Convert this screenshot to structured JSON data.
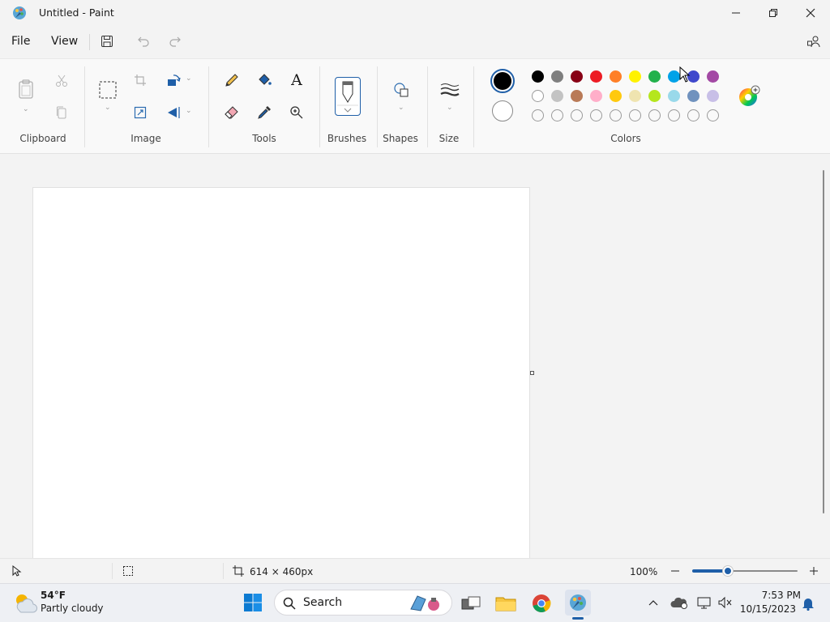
{
  "window": {
    "title": "Untitled - Paint"
  },
  "menu": {
    "file": "File",
    "view": "View"
  },
  "ribbon": {
    "groups": {
      "clipboard": "Clipboard",
      "image": "Image",
      "tools": "Tools",
      "brushes": "Brushes",
      "shapes": "Shapes",
      "size": "Size",
      "colors": "Colors"
    },
    "tools": {
      "text_glyph": "A"
    }
  },
  "colors": {
    "primary": "#000000",
    "secondary": "#ffffff",
    "row1": [
      "#000000",
      "#7f7f7f",
      "#880015",
      "#ed1c24",
      "#ff7f27",
      "#fff200",
      "#22b14c",
      "#00a2e8",
      "#3f48cc",
      "#a349a4"
    ],
    "row2": [
      "#ffffff",
      "#c3c3c3",
      "#b97a57",
      "#ffaec9",
      "#ffc90e",
      "#efe4b0",
      "#b5e61d",
      "#99d9ea",
      "#7092be",
      "#c8bfe7"
    ],
    "row3_count": 10
  },
  "status": {
    "canvas_size": "614 × 460px",
    "zoom": "100%",
    "zoom_fraction": 0.34
  },
  "taskbar": {
    "weather_temp": "54°F",
    "weather_desc": "Partly cloudy",
    "search_label": "Search",
    "time": "7:53 PM",
    "date": "10/15/2023"
  }
}
